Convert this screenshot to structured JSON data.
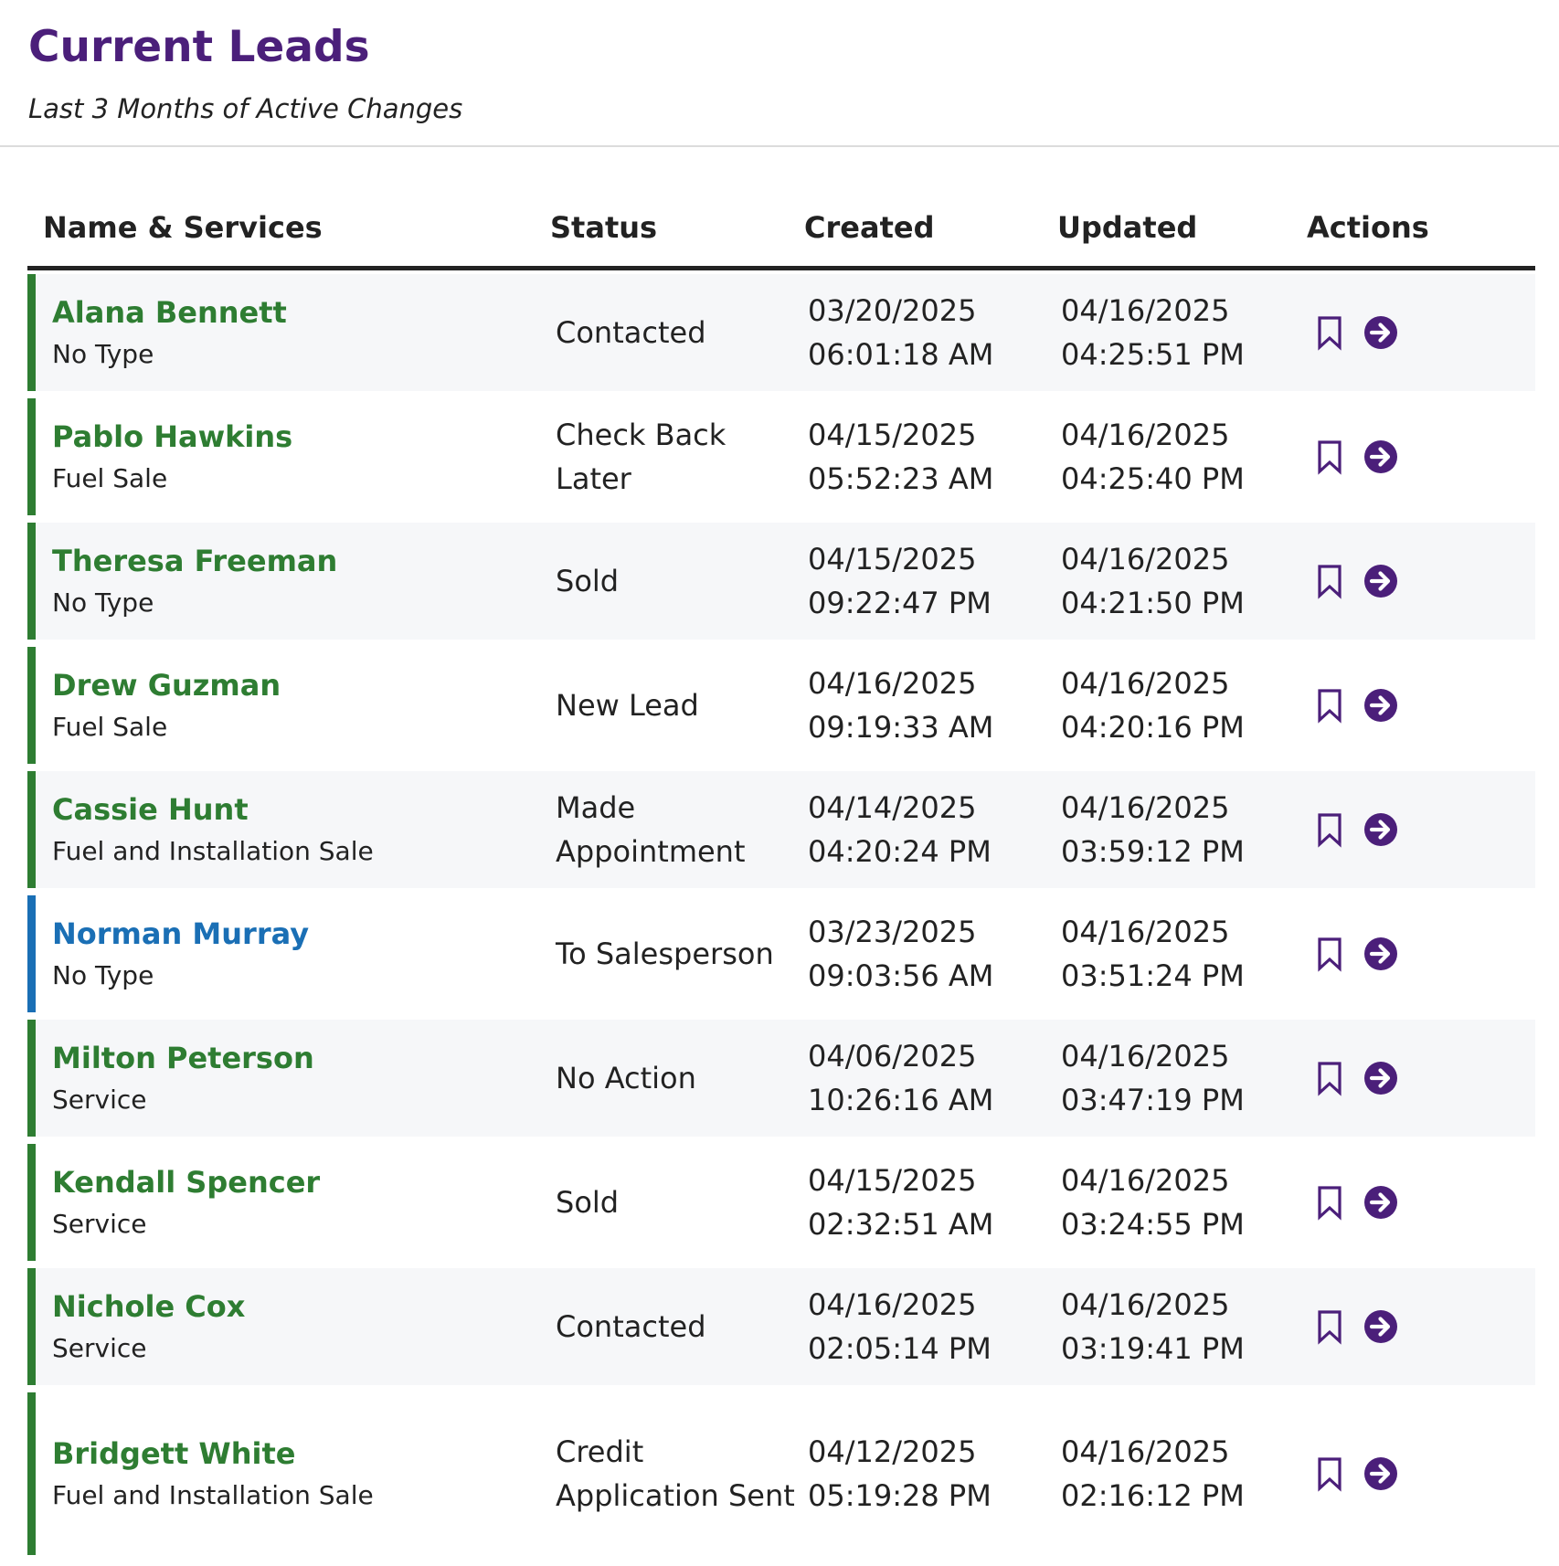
{
  "header": {
    "title": "Current Leads",
    "subtitle": "Last 3 Months of Active Changes"
  },
  "table": {
    "columns": {
      "name": "Name & Services",
      "status": "Status",
      "created": "Created",
      "updated": "Updated",
      "actions": "Actions"
    },
    "rows": [
      {
        "name": "Alana Bennett",
        "type": "No Type",
        "status": "Contacted",
        "created_date": "03/20/2025",
        "created_time": "06:01:18 AM",
        "updated_date": "04/16/2025",
        "updated_time": "04:25:51 PM",
        "accent": "green"
      },
      {
        "name": "Pablo Hawkins",
        "type": "Fuel Sale",
        "status": "Check Back Later",
        "created_date": "04/15/2025",
        "created_time": "05:52:23 AM",
        "updated_date": "04/16/2025",
        "updated_time": "04:25:40 PM",
        "accent": "green"
      },
      {
        "name": "Theresa Freeman",
        "type": "No Type",
        "status": "Sold",
        "created_date": "04/15/2025",
        "created_time": "09:22:47 PM",
        "updated_date": "04/16/2025",
        "updated_time": "04:21:50 PM",
        "accent": "green"
      },
      {
        "name": "Drew Guzman",
        "type": "Fuel Sale",
        "status": "New Lead",
        "created_date": "04/16/2025",
        "created_time": "09:19:33 AM",
        "updated_date": "04/16/2025",
        "updated_time": "04:20:16 PM",
        "accent": "green"
      },
      {
        "name": "Cassie Hunt",
        "type": "Fuel and Installation Sale",
        "status": "Made Appointment",
        "created_date": "04/14/2025",
        "created_time": "04:20:24 PM",
        "updated_date": "04/16/2025",
        "updated_time": "03:59:12 PM",
        "accent": "green"
      },
      {
        "name": "Norman Murray",
        "type": "No Type",
        "status": "To Salesperson",
        "created_date": "03/23/2025",
        "created_time": "09:03:56 AM",
        "updated_date": "04/16/2025",
        "updated_time": "03:51:24 PM",
        "accent": "blue"
      },
      {
        "name": "Milton Peterson",
        "type": "Service",
        "status": "No Action",
        "created_date": "04/06/2025",
        "created_time": "10:26:16 AM",
        "updated_date": "04/16/2025",
        "updated_time": "03:47:19 PM",
        "accent": "green"
      },
      {
        "name": "Kendall Spencer",
        "type": "Service",
        "status": "Sold",
        "created_date": "04/15/2025",
        "created_time": "02:32:51 AM",
        "updated_date": "04/16/2025",
        "updated_time": "03:24:55 PM",
        "accent": "green"
      },
      {
        "name": "Nichole Cox",
        "type": "Service",
        "status": "Contacted",
        "created_date": "04/16/2025",
        "created_time": "02:05:14 PM",
        "updated_date": "04/16/2025",
        "updated_time": "03:19:41 PM",
        "accent": "green"
      },
      {
        "name": "Bridgett White",
        "type": "Fuel and Installation Sale",
        "status": "Credit Application Sent",
        "created_date": "04/12/2025",
        "created_time": "05:19:28 PM",
        "updated_date": "04/16/2025",
        "updated_time": "02:16:12 PM",
        "accent": "green"
      }
    ]
  },
  "colors": {
    "title": "#4b1f7a",
    "green": "#2e7d32",
    "blue": "#1a6fb5",
    "icon": "#4b1f7a",
    "row_shade": "#f6f7f9"
  },
  "icons": {
    "bookmark": "bookmark-icon",
    "go": "arrow-circle-right-icon"
  }
}
